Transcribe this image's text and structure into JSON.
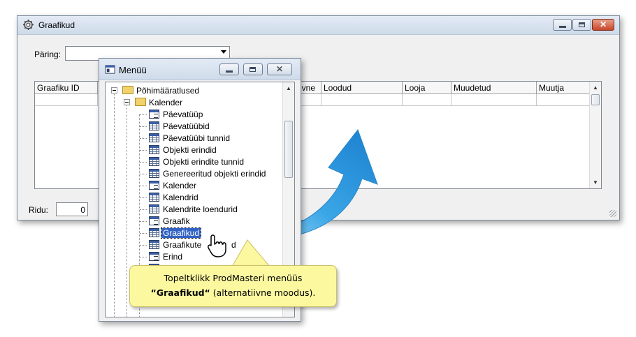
{
  "main_window": {
    "title": "Graafikud",
    "query_label": "Päring:",
    "query_value": "",
    "columns": [
      "Graafiku ID",
      "ivne",
      "Loodud",
      "Looja",
      "Muudetud",
      "Muutja"
    ],
    "rows_label": "Ridu:",
    "rows_value": "0"
  },
  "menu_window": {
    "title": "Menüü",
    "tree": [
      {
        "label": "Põhimääratlused",
        "icon": "folder-open-icon",
        "level": 0
      },
      {
        "label": "Kalender",
        "icon": "folder-open-icon",
        "level": 1
      },
      {
        "label": "Päevatüüp",
        "icon": "form-icon",
        "level": 2
      },
      {
        "label": "Päevatüübid",
        "icon": "table-icon",
        "level": 2
      },
      {
        "label": "Päevatüübi tunnid",
        "icon": "table-icon",
        "level": 2
      },
      {
        "label": "Objekti erindid",
        "icon": "table-icon",
        "level": 2
      },
      {
        "label": "Objekti erindite tunnid",
        "icon": "table-icon",
        "level": 2
      },
      {
        "label": "Genereeritud objekti erindid",
        "icon": "table-icon",
        "level": 2
      },
      {
        "label": "Kalender",
        "icon": "form-icon",
        "level": 2
      },
      {
        "label": "Kalendrid",
        "icon": "table-icon",
        "level": 2
      },
      {
        "label": "Kalendrite loendurid",
        "icon": "table-icon",
        "level": 2
      },
      {
        "label": "Graafik",
        "icon": "form-icon",
        "level": 2
      },
      {
        "label": "Graafikud",
        "icon": "table-icon",
        "level": 2,
        "selected": true
      },
      {
        "label": "Graafikute",
        "suffix": "d",
        "icon": "table-icon",
        "level": 2
      },
      {
        "label": "Erind",
        "icon": "form-icon",
        "level": 2
      }
    ]
  },
  "callout": {
    "line1": "Topeltklikk ProdMasteri menüüs",
    "line2_bold": "“Graafikud“",
    "line2_rest": " (alternatiivne moodus)."
  },
  "colors": {
    "arrow": "#3aa6e6",
    "selection": "#3162c4",
    "callout_bg": "#fcf8a0"
  }
}
